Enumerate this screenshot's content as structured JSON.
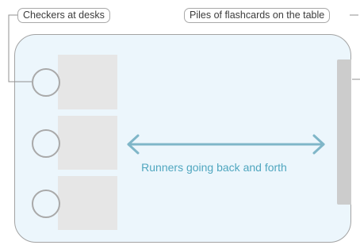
{
  "labels": {
    "checkers": "Checkers at desks",
    "flashcards": "Piles of flashcards on the table",
    "runners": "Runners going back and forth"
  },
  "colors": {
    "room_fill": "#ecf6fc",
    "room_border": "#a3a3a3",
    "desk": "#e6e6e6",
    "table": "#cccccc",
    "arrow": "#7fb6c8",
    "runners_text": "#4fa6bf",
    "leader_line": "#909090"
  }
}
